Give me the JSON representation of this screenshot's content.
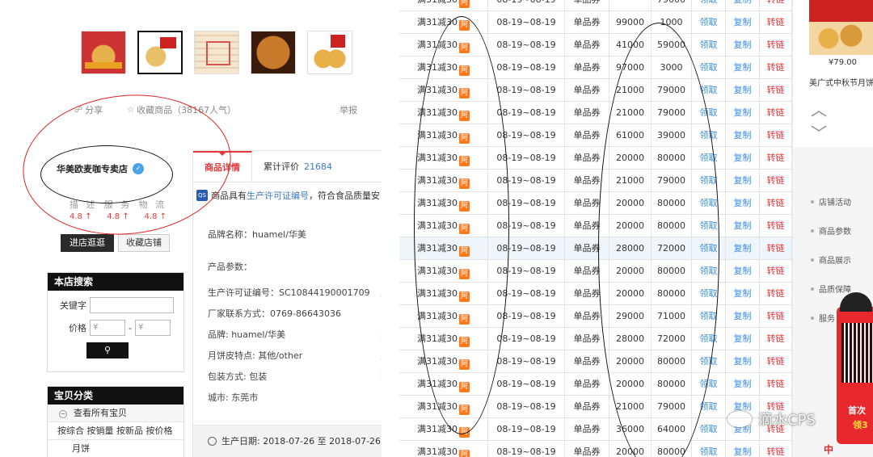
{
  "left": {
    "share": "分享",
    "favorite": "收藏商品",
    "favorite_count": "（38167人气）",
    "report": "举报",
    "shop_name": "华美欧麦咖专卖店",
    "ratings": {
      "labels": [
        "描 述",
        "服 务",
        "物 流"
      ],
      "values": [
        "4.8 ↑",
        "4.8 ↑",
        "4.8 ↑"
      ]
    },
    "enter_shop": "进店逛逛",
    "fav_shop": "收藏店铺",
    "search": {
      "title": "本店搜索",
      "keyword_label": "关键字",
      "price_label": "价格",
      "price_min_placeholder": "¥",
      "price_max_placeholder": "¥",
      "dash": "-"
    },
    "category": {
      "title": "宝贝分类",
      "all": "查看所有宝贝",
      "sort": "按综合 按销量 按新品 按价格",
      "next": "月饼"
    },
    "tabs": {
      "detail": "商品详情",
      "reviews": "累计评价",
      "review_count": "21684"
    },
    "qs": {
      "badge": "QS",
      "pre": "商品具有",
      "link": "生产许可证编号",
      "post": "，符合食品质量安"
    },
    "attrs": {
      "brand_name": "品牌名称：huamel/华美",
      "params_title": "产品参数：",
      "license": "生产许可证编号：SC10844190001709",
      "contact": "厂家联系方式：0769-86643036",
      "brand": "品牌: huamel/华美",
      "crust": "月饼皮特点: 其他/other",
      "package": "包装方式: 包装",
      "city": "城市: 东莞市"
    },
    "attrs_right": [
      "厂",
      "",
      "重",
      "月",
      "净"
    ],
    "production_date": "生产日期: 2018-07-26 至 2018-07-26"
  },
  "table": {
    "coupon": "满31减30",
    "a_tag": "阿",
    "date": "08-19~08-19",
    "type": "单品券",
    "claim": "领取",
    "copy": "复制",
    "convert": "转链",
    "rows": [
      {
        "total": "",
        "remain": "79000"
      },
      {
        "total": "99000",
        "remain": "1000"
      },
      {
        "total": "41000",
        "remain": "59000"
      },
      {
        "total": "97000",
        "remain": "3000"
      },
      {
        "total": "21000",
        "remain": "79000"
      },
      {
        "total": "21000",
        "remain": "79000"
      },
      {
        "total": "61000",
        "remain": "39000"
      },
      {
        "total": "20000",
        "remain": "80000"
      },
      {
        "total": "21000",
        "remain": "79000"
      },
      {
        "total": "20000",
        "remain": "80000"
      },
      {
        "total": "20000",
        "remain": "80000"
      },
      {
        "total": "28000",
        "remain": "72000"
      },
      {
        "total": "20000",
        "remain": "80000"
      },
      {
        "total": "20000",
        "remain": "80000"
      },
      {
        "total": "29000",
        "remain": "71000"
      },
      {
        "total": "28000",
        "remain": "72000"
      },
      {
        "total": "20000",
        "remain": "80000"
      },
      {
        "total": "20000",
        "remain": "80000"
      },
      {
        "total": "21000",
        "remain": "79000"
      },
      {
        "total": "36000",
        "remain": "64000"
      },
      {
        "total": "20000",
        "remain": "80000"
      }
    ]
  },
  "right": {
    "price": "¥79.00",
    "title": "美广式中秋节月饼",
    "arrows": "︿ ﹀",
    "items": [
      "店铺活动",
      "商品参数",
      "商品展示",
      "品质保障",
      "服务"
    ],
    "promo_line1": "首次",
    "promo_line2": "领3",
    "logo": "中"
  },
  "watermark": "滴水CPS"
}
